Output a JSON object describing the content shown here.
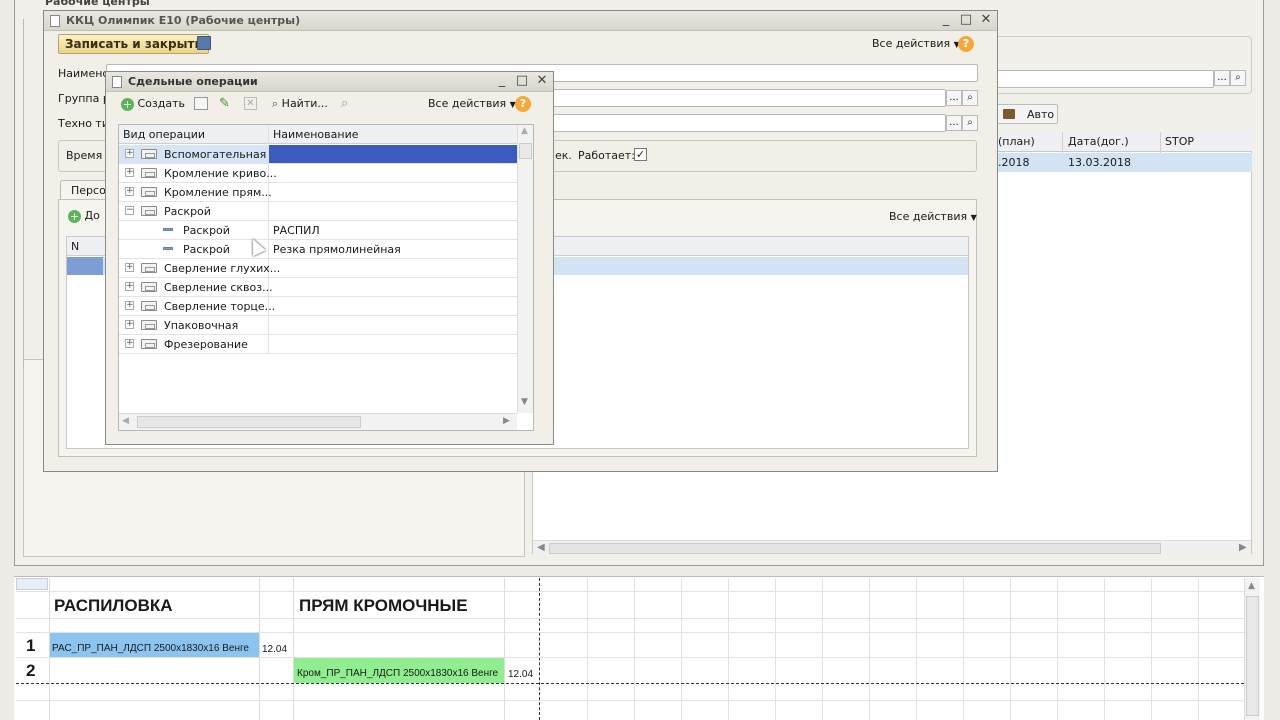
{
  "bg_window": {
    "title": "Рабочие центры"
  },
  "right_panel": {
    "auto_label": "Авто",
    "columns": [
      "(план)",
      "Дата(дог.)",
      "STOP"
    ],
    "row": {
      "plan": ".2018",
      "date": "13.03.2018",
      "stop": ""
    }
  },
  "main_window": {
    "title": "ККЦ Олимпик Е10 (Рабочие центры)",
    "save_close_label": "Записать и закрыть",
    "all_actions_label": "Все действия",
    "help_label": "?",
    "name_label": "Наименс",
    "group_label": "Группа р",
    "tech_label": "Техно ти",
    "time_label": "Время",
    "works_suffix": "ек.",
    "works_label": "Работает:",
    "works_checked": true,
    "tab_label": "Персо",
    "add_label": "До",
    "inner_all_actions": "Все действия",
    "col_n": "N"
  },
  "dialog": {
    "title": "Сдельные операции",
    "create_label": "Создать",
    "find_label": "Найти...",
    "all_actions_label": "Все действия",
    "col_op_type": "Вид операции",
    "col_name": "Наименование",
    "rows": [
      {
        "type": "group",
        "label": "Вспомогательная",
        "name": "",
        "expander": "+",
        "selected": true
      },
      {
        "type": "group",
        "label": "Кромление криво...",
        "name": "",
        "expander": "+"
      },
      {
        "type": "group",
        "label": "Кромление прям...",
        "name": "",
        "expander": "+"
      },
      {
        "type": "group",
        "label": "Раскрой",
        "name": "",
        "expander": "−"
      },
      {
        "type": "item",
        "label": "Раскрой",
        "name": "РАСПИЛ"
      },
      {
        "type": "item",
        "label": "Раскрой",
        "name": "Резка прямолинейная"
      },
      {
        "type": "group",
        "label": "Сверление глухих...",
        "name": "",
        "expander": "+"
      },
      {
        "type": "group",
        "label": "Сверление сквоз...",
        "name": "",
        "expander": "+"
      },
      {
        "type": "group",
        "label": "Сверление торце...",
        "name": "",
        "expander": "+"
      },
      {
        "type": "group",
        "label": "Упаковочная",
        "name": "",
        "expander": "+"
      },
      {
        "type": "group",
        "label": "Фрезерование",
        "name": "",
        "expander": "+"
      }
    ]
  },
  "sheet": {
    "header_left": "РАСПИЛОВКА",
    "header_right": "ПРЯМ КРОМОЧНЫЕ",
    "row1_num": "1",
    "row2_num": "2",
    "row1_text": "РАС_ПР_ПАН_ЛДСП 2500x1830x16 Венге",
    "row1_date": "12.04",
    "row2_text": "Кром_ПР_ПАН_ЛДСП 2500x1830x16 Венге",
    "row2_date": "12.04",
    "colors": {
      "row1_fill": "#8cc4f0",
      "row2_fill": "#90ee90"
    }
  }
}
